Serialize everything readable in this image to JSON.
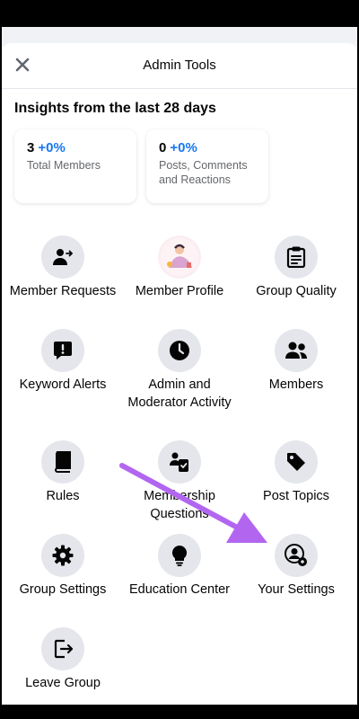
{
  "header": {
    "title": "Admin Tools",
    "close_icon": "close-icon"
  },
  "insights": {
    "title": "Insights from the last 28 days",
    "cards": [
      {
        "value": "3",
        "change": "+0%",
        "label": "Total Members"
      },
      {
        "value": "0",
        "change": "+0%",
        "label": "Posts, Comments and Reactions"
      }
    ]
  },
  "tools": [
    {
      "label": "Member Requests",
      "icon": "member-requests-icon"
    },
    {
      "label": "Member Profile",
      "icon": "member-profile-avatar"
    },
    {
      "label": "Group Quality",
      "icon": "clipboard-icon"
    },
    {
      "label": "Keyword Alerts",
      "icon": "alert-bubble-icon"
    },
    {
      "label": "Admin and Moderator Activity",
      "icon": "clock-icon"
    },
    {
      "label": "Members",
      "icon": "people-icon"
    },
    {
      "label": "Rules",
      "icon": "book-icon"
    },
    {
      "label": "Membership Questions",
      "icon": "member-questions-icon"
    },
    {
      "label": "Post Topics",
      "icon": "tag-icon"
    },
    {
      "label": "Group Settings",
      "icon": "gear-icon"
    },
    {
      "label": "Education Center",
      "icon": "lightbulb-icon"
    },
    {
      "label": "Your Settings",
      "icon": "user-settings-icon"
    },
    {
      "label": "Leave Group",
      "icon": "exit-icon"
    }
  ],
  "colors": {
    "accent": "#1877f2",
    "arrow": "#b266f0"
  }
}
